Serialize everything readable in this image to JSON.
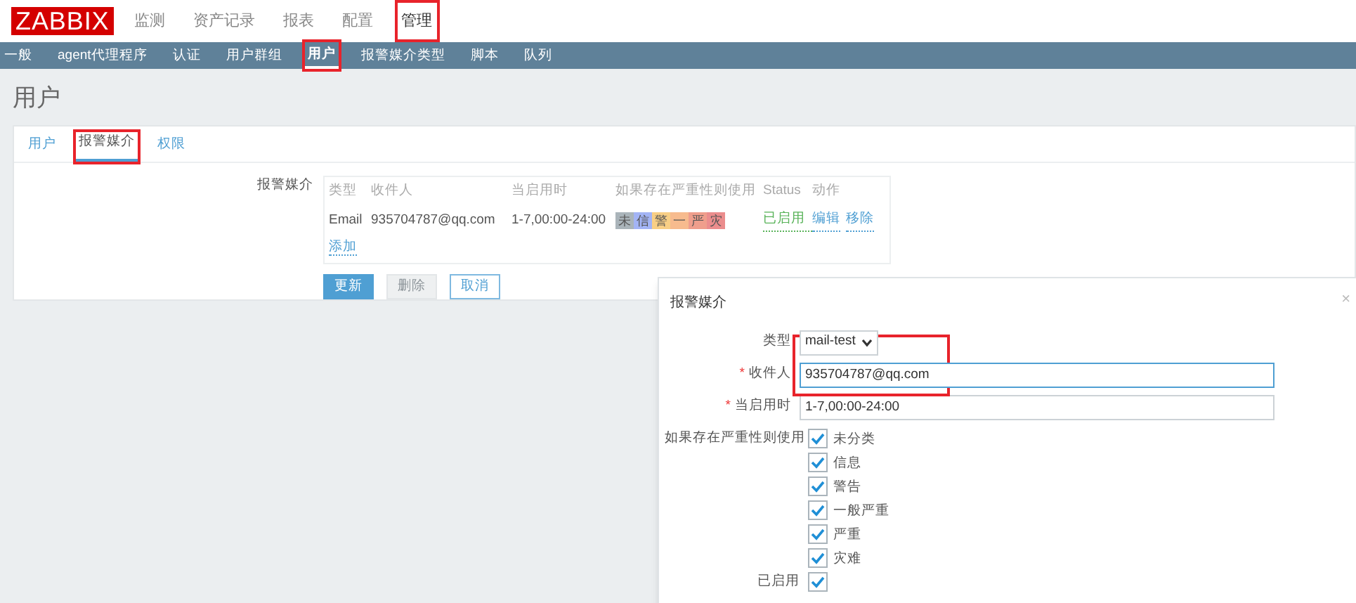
{
  "logo": "ZABBIX",
  "top_menu": [
    {
      "label": "监测",
      "selected": false,
      "highlighted": false
    },
    {
      "label": "资产记录",
      "selected": false,
      "highlighted": false
    },
    {
      "label": "报表",
      "selected": false,
      "highlighted": false
    },
    {
      "label": "配置",
      "selected": false,
      "highlighted": false
    },
    {
      "label": "管理",
      "selected": true,
      "highlighted": true
    }
  ],
  "sub_menu": [
    {
      "label": "一般",
      "selected": false,
      "highlighted": false
    },
    {
      "label": "agent代理程序",
      "selected": false,
      "highlighted": false
    },
    {
      "label": "认证",
      "selected": false,
      "highlighted": false
    },
    {
      "label": "用户群组",
      "selected": false,
      "highlighted": false
    },
    {
      "label": "用户",
      "selected": true,
      "highlighted": true
    },
    {
      "label": "报警媒介类型",
      "selected": false,
      "highlighted": false
    },
    {
      "label": "脚本",
      "selected": false,
      "highlighted": false
    },
    {
      "label": "队列",
      "selected": false,
      "highlighted": false
    }
  ],
  "page_title": "用户",
  "tabs": [
    {
      "label": "用户",
      "selected": false,
      "highlighted": false
    },
    {
      "label": "报警媒介",
      "selected": true,
      "highlighted": true
    },
    {
      "label": "权限",
      "selected": false,
      "highlighted": false
    }
  ],
  "media": {
    "label": "报警媒介",
    "columns": [
      "类型",
      "收件人",
      "当启用时",
      "如果存在严重性则使用",
      "Status",
      "动作"
    ],
    "rows": [
      {
        "type": "Email",
        "recipient": "935704787@qq.com",
        "when": "1-7,00:00-24:00",
        "severities": [
          {
            "label": "未",
            "color": "#aab4ba"
          },
          {
            "label": "信",
            "color": "#a3b4f5"
          },
          {
            "label": "警",
            "color": "#f8cf85"
          },
          {
            "label": "一",
            "color": "#f7bb8e"
          },
          {
            "label": "严",
            "color": "#ef9e8c"
          },
          {
            "label": "灾",
            "color": "#eb8d8d"
          }
        ],
        "status": "已启用",
        "actions": [
          "编辑",
          "移除"
        ]
      }
    ],
    "add_link": "添加"
  },
  "buttons": [
    {
      "label": "更新",
      "kind": "primary"
    },
    {
      "label": "删除",
      "kind": "disabled"
    },
    {
      "label": "取消",
      "kind": "outline"
    }
  ],
  "dialog": {
    "title": "报警媒介",
    "close": "×",
    "type_label": "类型",
    "type_value": "mail-test",
    "required_mark": "*",
    "recipient_label": "收件人",
    "recipient_required": true,
    "recipient_value": "935704787@qq.com",
    "when_label": "当启用时",
    "when_required": true,
    "when_value": "1-7,00:00-24:00",
    "fields_highlighted": true,
    "severity_label": "如果存在严重性则使用",
    "severities": [
      {
        "label": "未分类",
        "checked": true
      },
      {
        "label": "信息",
        "checked": true
      },
      {
        "label": "警告",
        "checked": true
      },
      {
        "label": "一般严重",
        "checked": true
      },
      {
        "label": "严重",
        "checked": true
      },
      {
        "label": "灾难",
        "checked": true
      }
    ],
    "enabled_label": "已启用",
    "enabled": true
  }
}
